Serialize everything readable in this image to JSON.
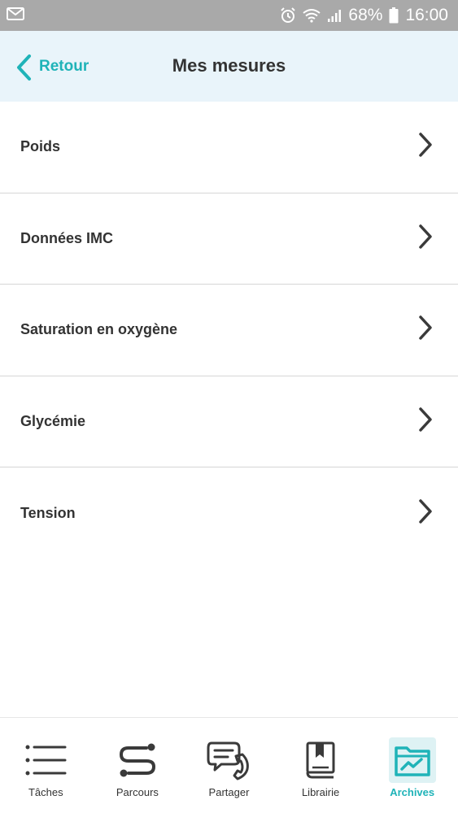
{
  "status_bar": {
    "battery_percent": "68%",
    "time": "16:00"
  },
  "header": {
    "back_label": "Retour",
    "title": "Mes mesures"
  },
  "list": {
    "items": [
      {
        "label": "Poids"
      },
      {
        "label": "Données IMC"
      },
      {
        "label": "Saturation en oxygène"
      },
      {
        "label": "Glycémie"
      },
      {
        "label": "Tension"
      }
    ]
  },
  "tab_bar": {
    "tabs": [
      {
        "label": "Tâches",
        "icon": "list-icon"
      },
      {
        "label": "Parcours",
        "icon": "route-icon"
      },
      {
        "label": "Partager",
        "icon": "chat-phone-icon"
      },
      {
        "label": "Librairie",
        "icon": "book-icon"
      },
      {
        "label": "Archives",
        "icon": "chart-folder-icon"
      }
    ],
    "active_index": 4
  },
  "colors": {
    "accent": "#1fb3b8",
    "header_bg": "#e9f4fa",
    "status_bar_bg": "#a9a9a9",
    "text": "#333333"
  }
}
